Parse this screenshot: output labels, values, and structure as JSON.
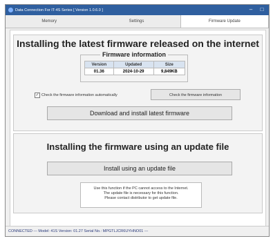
{
  "window": {
    "title": "Data Connection For IT-4S Series  [ Version 1.0.6.0 ]",
    "minimize": "–",
    "maximize": "□"
  },
  "tabs": [
    "Memory",
    "Settings",
    "Firmware Update"
  ],
  "active_tab": "Firmware Update",
  "section_internet": {
    "heading": "Installing the latest firmware released on the internet site",
    "group_title": "Firmware information",
    "columns": [
      "Version",
      "Updated",
      "Size"
    ],
    "values": [
      "01.36",
      "2024-10-29",
      "9,849KB"
    ],
    "checkbox_label": "Check the firmware information automatically",
    "checkbox_checked": true,
    "check_button": "Check the firmware information",
    "download_button": "Download and install latest firmware"
  },
  "section_file": {
    "heading": "Installing the firmware using an update file",
    "install_button": "Install using an update file",
    "notes": [
      "Use this function if the PC cannot access to the Internet.",
      "The update file is necessary for this function.",
      "Please contact distributor to get update file."
    ]
  },
  "status_bar": "CONNECTED    ---  Model: 41S  Version: 01.27  Serial No.: MPGTLJCR6UYHNO01  ---"
}
